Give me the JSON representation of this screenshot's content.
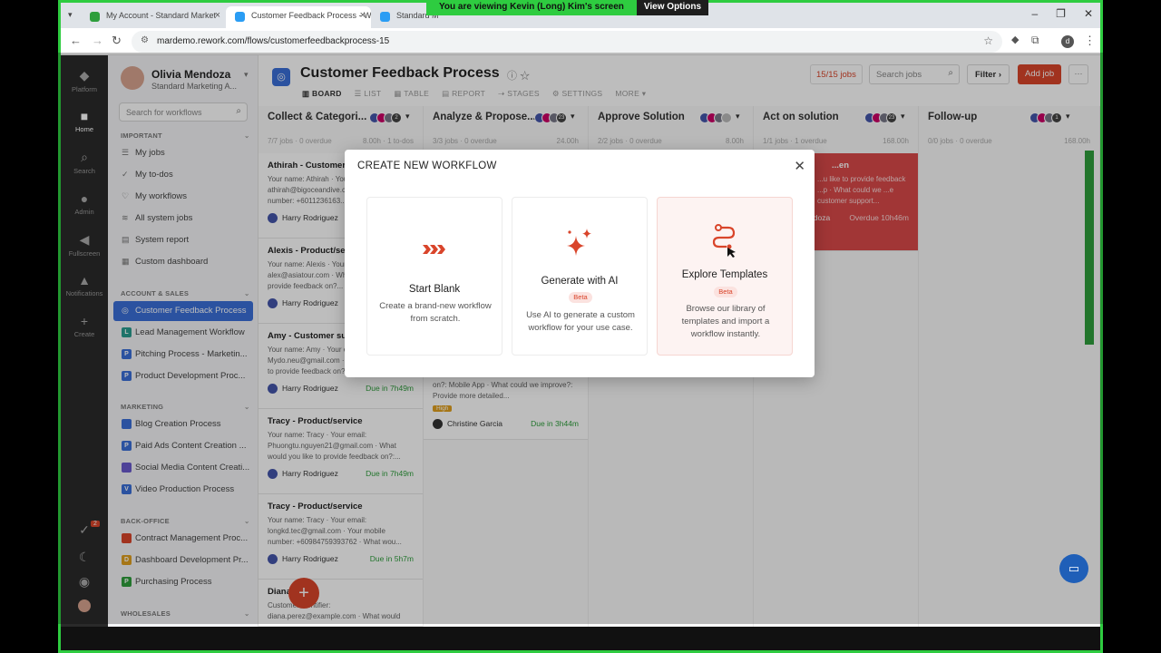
{
  "banner": {
    "message": "You are viewing  Kevin (Long) Kim's screen",
    "options": "View Options"
  },
  "browser": {
    "tabs": [
      {
        "title": "My Account - Standard Market",
        "color": "#2e9e3c"
      },
      {
        "title": "Customer Feedback Process - W",
        "color": "#2a9df4"
      },
      {
        "title": "Standard M",
        "color": "#2a9df4"
      }
    ],
    "url": "mardemo.rework.com/flows/customerfeedbackprocess-15"
  },
  "rail": [
    {
      "label": "Platform",
      "icon": "platform-icon",
      "glyph": "◆"
    },
    {
      "label": "Home",
      "icon": "home-icon",
      "glyph": "■"
    },
    {
      "label": "Search",
      "icon": "search-icon",
      "glyph": "⌕"
    },
    {
      "label": "Admin",
      "icon": "admin-icon",
      "glyph": "●"
    },
    {
      "label": "Fullscreen",
      "icon": "fullscreen-icon",
      "glyph": "◀"
    },
    {
      "label": "Notifications",
      "icon": "bell-icon",
      "glyph": "▲"
    },
    {
      "label": "Create",
      "icon": "plus-icon",
      "glyph": "+"
    }
  ],
  "rail_bottom": {
    "badge": "2"
  },
  "profile": {
    "name": "Olivia Mendoza",
    "role": "Standard Marketing A..."
  },
  "sidebar": {
    "search_placeholder": "Search for workflows",
    "important_label": "IMPORTANT",
    "important": [
      "My jobs",
      "My to-dos",
      "My workflows",
      "All system jobs",
      "System report",
      "Custom dashboard"
    ],
    "account_label": "ACCOUNT & SALES",
    "account": [
      {
        "label": "Customer Feedback Process",
        "letter": "",
        "color": "#3a6fd8"
      },
      {
        "label": "Lead Management Workflow",
        "letter": "L",
        "color": "#2a9d8f"
      },
      {
        "label": "Pitching Process - Marketin...",
        "letter": "P",
        "color": "#3a6fd8"
      },
      {
        "label": "Product Development Proc...",
        "letter": "P",
        "color": "#3a6fd8"
      }
    ],
    "marketing_label": "MARKETING",
    "marketing": [
      {
        "label": "Blog Creation Process",
        "letter": "",
        "color": "#3a6fd8"
      },
      {
        "label": "Paid Ads Content Creation ...",
        "letter": "P",
        "color": "#3a6fd8"
      },
      {
        "label": "Social Media Content Creati...",
        "letter": "",
        "color": "#6a5acd"
      },
      {
        "label": "Video Production Process",
        "letter": "V",
        "color": "#3a6fd8"
      }
    ],
    "backoffice_label": "BACK-OFFICE",
    "backoffice": [
      {
        "label": "Contract Management Proc...",
        "letter": "",
        "color": "#d9452b"
      },
      {
        "label": "Dashboard Development Pr...",
        "letter": "D",
        "color": "#e0a020"
      },
      {
        "label": "Purchasing Process",
        "letter": "P",
        "color": "#2e9e3c"
      }
    ],
    "wholesales_label": "WHOLESALES"
  },
  "header": {
    "title": "Customer Feedback Process",
    "jobs_badge": "15/15 jobs",
    "search_placeholder": "Search jobs",
    "filter": "Filter",
    "add_job": "Add job",
    "more": "···",
    "view_tabs": [
      "BOARD",
      "LIST",
      "TABLE",
      "REPORT",
      "STAGES",
      "SETTINGS",
      "MORE"
    ]
  },
  "columns": [
    {
      "title": "Collect & Categori...",
      "count": "2",
      "stats": "7/7 jobs · 0 overdue",
      "stats2": "8.00h · 1 to-dos"
    },
    {
      "title": "Analyze & Propose...",
      "count": "23",
      "stats": "3/3 jobs · 0 overdue",
      "stats2": "24.00h"
    },
    {
      "title": "Approve Solution",
      "count": "",
      "stats": "2/2 jobs · 0 overdue",
      "stats2": "8.00h"
    },
    {
      "title": "Act on solution",
      "count": "23",
      "stats": "1/1 jobs · 1 overdue",
      "stats2": "168.00h"
    },
    {
      "title": "Follow-up",
      "count": "1",
      "stats": "0/0 jobs · 0 overdue",
      "stats2": "168.00h"
    }
  ],
  "cards_col1": [
    {
      "title": "Athirah - Customer...",
      "body": "Your name: Athirah · Your email: athirah@bigoceandive.com · Your mobile number: +6011236163...",
      "person": "Harry Rodriguez",
      "due": ""
    },
    {
      "title": "Alexis - Product/service",
      "body": "Your name: Alexis · Your email: alex@asiatour.com · What would you like to provide feedback on?...",
      "person": "Harry Rodriguez",
      "due": ""
    },
    {
      "title": "Amy - Customer su...",
      "body": "Your name: Amy · Your email: Mydo.neu@gmail.com · What would you like to provide feedback on?...",
      "person": "Harry Rodriguez",
      "due": "Due in 7h49m"
    },
    {
      "title": "Tracy - Product/service",
      "body": "Your name: Tracy · Your email: Phuongtu.nguyen21@gmail.com · What would you like to provide feedback on?:...",
      "person": "Harry Rodriguez",
      "due": "Due in 7h49m"
    },
    {
      "title": "Tracy - Product/service",
      "body": "Your name: Tracy · Your email: longkd.tec@gmail.com · Your mobile number: +60984759393762 · What wou...",
      "person": "Harry Rodriguez",
      "due": "Due in 5h7m"
    },
    {
      "title": "Diana Perez",
      "body": "Customer identifier: diana.perez@example.com · What would",
      "person": "",
      "due": ""
    }
  ],
  "card_col2": {
    "body": "on?: Mobile App · What could we improve?: Provide more detailed...",
    "tag": "High",
    "person": "Christine Garcia",
    "due": "Due in 3h44m"
  },
  "card_col4": {
    "title": "...en",
    "body": "...u like to provide feedback ...p · What could we ...e customer support...",
    "person": "...ndoza",
    "due": "Overdue 10h46m"
  },
  "modal": {
    "title": "CREATE NEW WORKFLOW",
    "options": [
      {
        "title": "Start Blank",
        "beta": "",
        "desc": "Create a brand-new workflow from scratch."
      },
      {
        "title": "Generate with AI",
        "beta": "Beta",
        "desc": "Use AI to generate a custom workflow for your use case."
      },
      {
        "title": "Explore Templates",
        "beta": "Beta",
        "desc": "Browse our library of templates and import a workflow instantly."
      }
    ]
  },
  "colors": {
    "accent": "#d9452b",
    "brand_blue": "#3a6fd8",
    "viewer_green": "#2ecc40"
  }
}
